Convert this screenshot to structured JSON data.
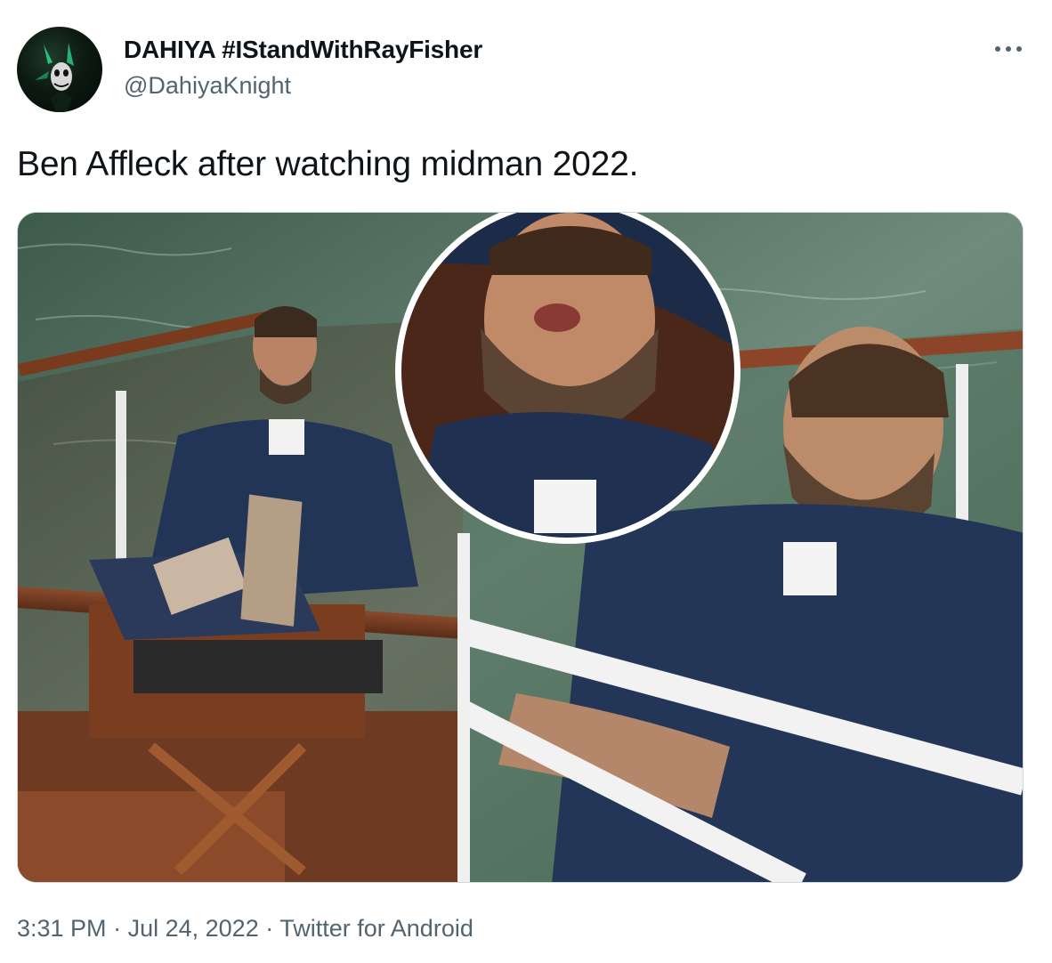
{
  "tweet": {
    "author": {
      "display_name": "DAHIYA #IStandWithRayFisher",
      "handle": "@DahiyaKnight"
    },
    "text": "Ben Affleck after watching midman 2022.",
    "meta": {
      "time": "3:31 PM",
      "separator": "·",
      "date": "Jul 24, 2022",
      "source": "Twitter for Android"
    },
    "colors": {
      "text": "#0f1419",
      "secondary": "#536471",
      "border": "#cfd9de"
    },
    "icons": {
      "more": "more-horizontal-icon"
    }
  }
}
